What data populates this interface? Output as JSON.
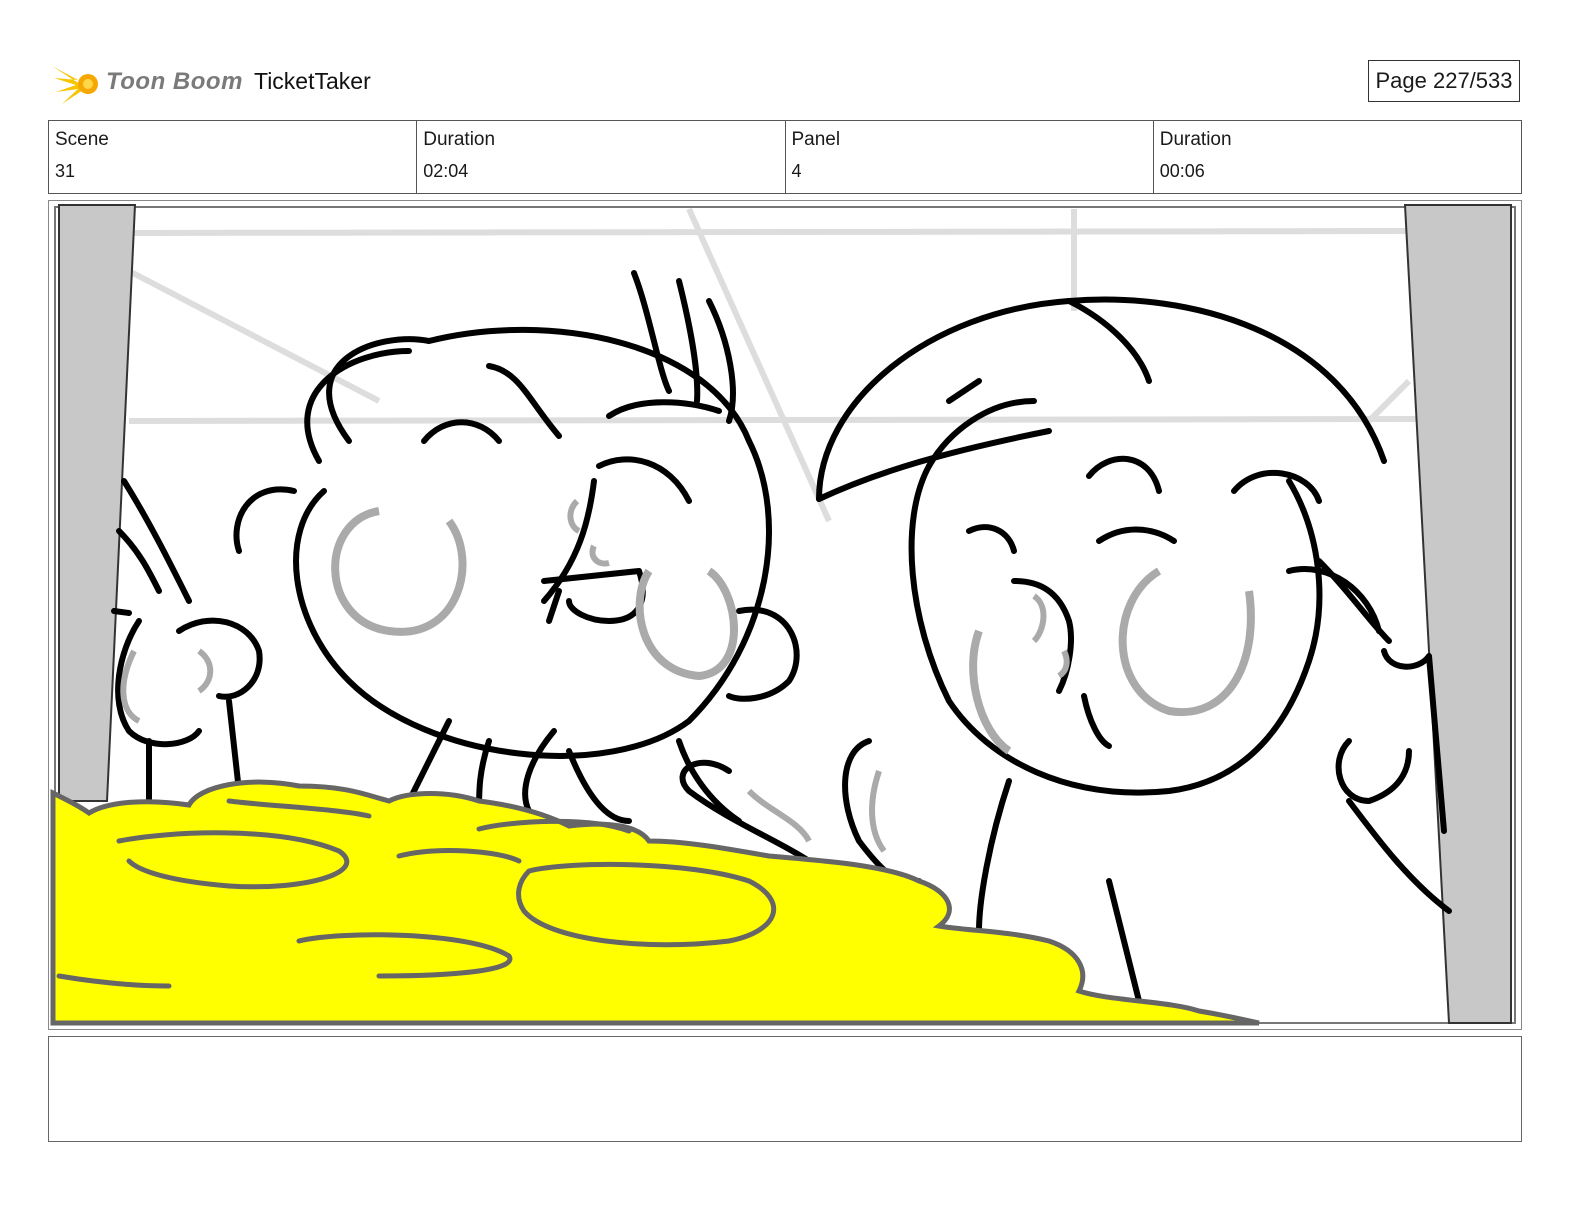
{
  "header": {
    "logo_text": "Toon Boom",
    "project_title": "TicketTaker",
    "page_indicator": "Page 227/533"
  },
  "info": [
    {
      "label": "Scene",
      "value": "31"
    },
    {
      "label": "Duration",
      "value": "02:04"
    },
    {
      "label": "Panel",
      "value": "4"
    },
    {
      "label": "Duration",
      "value": "00:06"
    }
  ],
  "panel": {
    "description": "",
    "colors": {
      "ink": "#000000",
      "cheek_shading": "#aaaaaa",
      "cheese": "#ffff00",
      "cheese_lines": "#666666",
      "frame_gray": "#c8c8c8"
    }
  },
  "notes": {
    "text": ""
  }
}
